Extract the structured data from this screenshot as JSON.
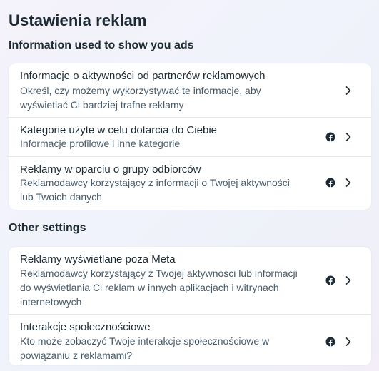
{
  "page": {
    "title": "Ustawienia reklam"
  },
  "sections": [
    {
      "heading": "Information used to show you ads",
      "items": [
        {
          "title": "Informacje o aktywności od partnerów reklamowych",
          "description": "Określ, czy możemy wykorzystywać te informacje, aby wyświetlać Ci bardziej trafne reklamy",
          "icon": null
        },
        {
          "title": "Kategorie użyte w celu dotarcia do Ciebie",
          "description": "Informacje profilowe i inne kategorie",
          "icon": "facebook-icon"
        },
        {
          "title": "Reklamy w oparciu o grupy odbiorców",
          "description": "Reklamodawcy korzystający z informacji o Twojej aktywności lub Twoich danych",
          "icon": "facebook-icon"
        }
      ]
    },
    {
      "heading": "Other settings",
      "items": [
        {
          "title": "Reklamy wyświetlane poza Meta",
          "description": "Reklamodawcy korzystający z Twojej aktywności lub informacji do wyświetlania Ci reklam w innych aplikacjach i witrynach internetowych",
          "icon": "facebook-icon"
        },
        {
          "title": "Interakcje społecznościowe",
          "description": "Kto może zobaczyć Twoje interakcje społecznościowe w powiązaniu z reklamami?",
          "icon": "facebook-icon"
        }
      ]
    }
  ],
  "colors": {
    "text_primary": "#1c2b33",
    "text_secondary": "#465a69",
    "card_bg": "#ffffff",
    "divider": "#e4e7eb"
  }
}
